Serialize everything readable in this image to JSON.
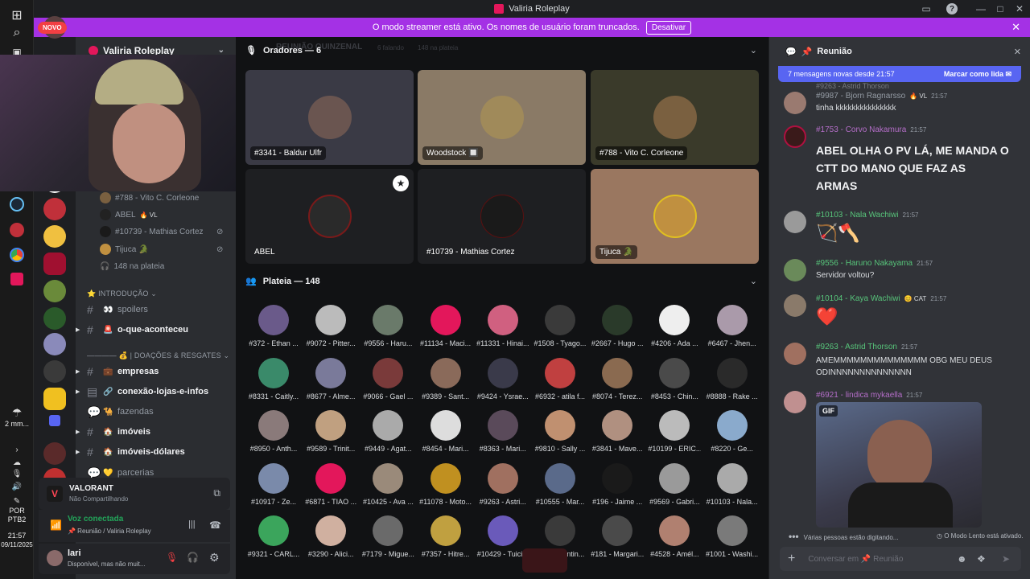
{
  "window": {
    "title": "Valiria Roleplay"
  },
  "banner": {
    "text": "O modo streamer está ativo. Os nomes de usuário foram truncados.",
    "button": "Desativar"
  },
  "novo_badge": "NOVO",
  "taskbar": {
    "weather": "2 mm...",
    "lang1": "POR",
    "lang2": "PTB2",
    "time": "21:57",
    "date": "09/11/2025"
  },
  "server": {
    "name": "Valiria Roleplay"
  },
  "voice_users": [
    {
      "name": "#788 - Vito C. Corleone",
      "badge": ""
    },
    {
      "name": "ABEL",
      "badge": "🔥 VL"
    },
    {
      "name": "#10739 - Mathias Cortez",
      "badge": ""
    },
    {
      "name": "Tijuca 🐊",
      "badge": ""
    }
  ],
  "audience_count": "148 na plateia",
  "categories": {
    "intro": "INTRODUÇÃO",
    "doacoes": "| DOAÇÕES & RESGATES"
  },
  "channels": [
    {
      "emoji": "👀",
      "name": "spoilers",
      "bright": false,
      "arrow": false
    },
    {
      "emoji": "🚨",
      "name": "o-que-aconteceu",
      "bright": true,
      "arrow": true
    },
    {
      "emoji": "💼",
      "name": "empresas",
      "bright": true,
      "arrow": true
    },
    {
      "emoji": "🔗",
      "name": "conexão-lojas-e-infos",
      "bright": true,
      "arrow": true
    },
    {
      "emoji": "🐪",
      "name": "fazendas",
      "bright": false,
      "arrow": false
    },
    {
      "emoji": "🏠",
      "name": "imóveis",
      "bright": true,
      "arrow": true
    },
    {
      "emoji": "🏠",
      "name": "imóveis-dólares",
      "bright": true,
      "arrow": true
    },
    {
      "emoji": "💛",
      "name": "parcerias",
      "bright": false,
      "arrow": false
    }
  ],
  "activity": {
    "game": "VALORANT",
    "status": "Não Compartilhando"
  },
  "voice_connected": {
    "title": "Voz conectada",
    "sub": "📌 Reunião / Valiria Roleplay"
  },
  "user": {
    "name": "lari",
    "status": "Disponível, mas não muit..."
  },
  "stage": {
    "bg_text": "REUNIÃO QUINZENAL",
    "speaking": "6 falando",
    "audience_small": "148 na plateia",
    "speakers_title": "Oradores — 6",
    "audience_title": "Plateia — 148"
  },
  "speakers": [
    {
      "label": "#3341 - Baldur Ulfr",
      "bg": "#3a3a45",
      "av": "#6a5550"
    },
    {
      "label": "Woodstock 🔲",
      "bg": "#8a7a66",
      "av": "#a08a5a"
    },
    {
      "label": "#788 - Vito C. Corleone",
      "bg": "#3a3a2a",
      "av": "#7a6040"
    },
    {
      "label": "ABEL",
      "bg": "#1e1f22",
      "av": "#2a2a2a"
    },
    {
      "label": "#10739 - Mathias Cortez",
      "bg": "#1e1f22",
      "av": "#1a1a1a"
    },
    {
      "label": "Tijuca 🐊",
      "bg": "#9a7760",
      "av": "#c09040"
    }
  ],
  "audience": [
    "#372 - Ethan ...",
    "#9072 - Pitter...",
    "#9556 - Haru...",
    "#11134 - Maci...",
    "#11331 - Hinai...",
    "#1508 - Tyago...",
    "#2667 - Hugo ...",
    "#4206 - Ada ...",
    "#6467 - Jhen...",
    "#8331 - Caitly...",
    "#8677 - Alme...",
    "#9066 - Gael ...",
    "#9389 - Sant...",
    "#9424 - Ysrae...",
    "#6932 - atila f...",
    "#8074 - Terez...",
    "#8453 - Chin...",
    "#8888 - Rake ...",
    "#8950 - Anth...",
    "#9589 - Trinit...",
    "#9449 - Agat...",
    "#8454 - Mari...",
    "#8363 - Mari...",
    "#9810 - Sally ...",
    "#3841 - Mave...",
    "#10199 - ERIC...",
    "#8220 - Ge...",
    "#10917 - Ze...",
    "#6871 - TIAO ...",
    "#10425 - Ava ...",
    "#11078 - Moto...",
    "#9263 - Astri...",
    "#10555 - Mar...",
    "#196 - Jaime ...",
    "#9569 - Gabri...",
    "#10103 - Nala...",
    "#9321 - CARL...",
    "#3290 - Alici...",
    "#7179 - Migue...",
    "#7357 - Hitre...",
    "#10429 - Tuici...",
    "#378 - Fontin...",
    "#181 - Margari...",
    "#4528 - Amél...",
    "#1001 - Washi..."
  ],
  "audience_colors": [
    "#6a5a8a",
    "#bbbbbb",
    "#6a7a6a",
    "#e3175b",
    "#d06080",
    "#3a3a3a",
    "#2a3a2a",
    "#eeeeee",
    "#aa9aaa",
    "#3a8a6a",
    "#7a7a9a",
    "#7a3a3a",
    "#8a6a5a",
    "#3a3a4a",
    "#c04040",
    "#8a6a50",
    "#4a4a4a",
    "#2a2a2a",
    "#8a7a7a",
    "#c0a080",
    "#aaaaaa",
    "#dddddd",
    "#5a4a5a",
    "#c09070",
    "#b09080",
    "#bbbbbb",
    "#8aaacc",
    "#7a8aaa",
    "#e3175b",
    "#9a8a7a",
    "#c09020",
    "#a07060",
    "#5a6a8a",
    "#1a1a1a",
    "#9a9a9a",
    "#aaaaaa",
    "#3ba55c",
    "#d0b0a0",
    "#6a6a6a",
    "#c0a040",
    "#6a5aba",
    "#3a3a3a",
    "#4a4a4a",
    "#b08070",
    "#7a7a7a"
  ],
  "chat": {
    "title": "Reunião",
    "new_messages": "7 mensagens novas desde 21:57",
    "mark_read": "Marcar como lida",
    "typing": "Várias pessoas estão digitando...",
    "slowmode": "O Modo Lento está ativado.",
    "placeholder": "Conversar em 📌 Reunião",
    "messages": [
      {
        "author": "#9987 - Bjorn Ragnarsso",
        "badge": "🔥 VL",
        "time": "21:57",
        "color": "#949ba4",
        "text": "tinha kkkkkkkkkkkkkkk"
      },
      {
        "author": "#1753 - Corvo Nakamura",
        "badge": "",
        "time": "21:57",
        "color": "#b56ec9",
        "text": "ABEL OLHA O PV LÁ, ME MANDA O CTT DO MANO QUE FAZ AS ARMAS"
      },
      {
        "author": "#10103 - Nala Wachiwi",
        "badge": "",
        "time": "21:57",
        "color": "#57c47a",
        "text": "🏹🪓"
      },
      {
        "author": "#9556 - Haruno Nakayama",
        "badge": "",
        "time": "21:57",
        "color": "#57c47a",
        "text": "Servidor voltou?"
      },
      {
        "author": "#10104 - Kaya Wachiwi",
        "badge": "😊 CAT",
        "time": "21:57",
        "color": "#57c47a",
        "text": "❤️"
      },
      {
        "author": "#9263 - Astrid Thorson",
        "badge": "",
        "time": "21:57",
        "color": "#57c47a",
        "text": "AMEMMMMMMMMMMMMMM OBG MEU DEUS ODINNNNNNNNNNNNNN"
      },
      {
        "author": "#6921 - lindica mykaella",
        "badge": "",
        "time": "21:57",
        "color": "#b56ec9",
        "text": ""
      }
    ],
    "partial_top": "#9263 - Astrid Thorson",
    "gif_label": "GIF"
  }
}
